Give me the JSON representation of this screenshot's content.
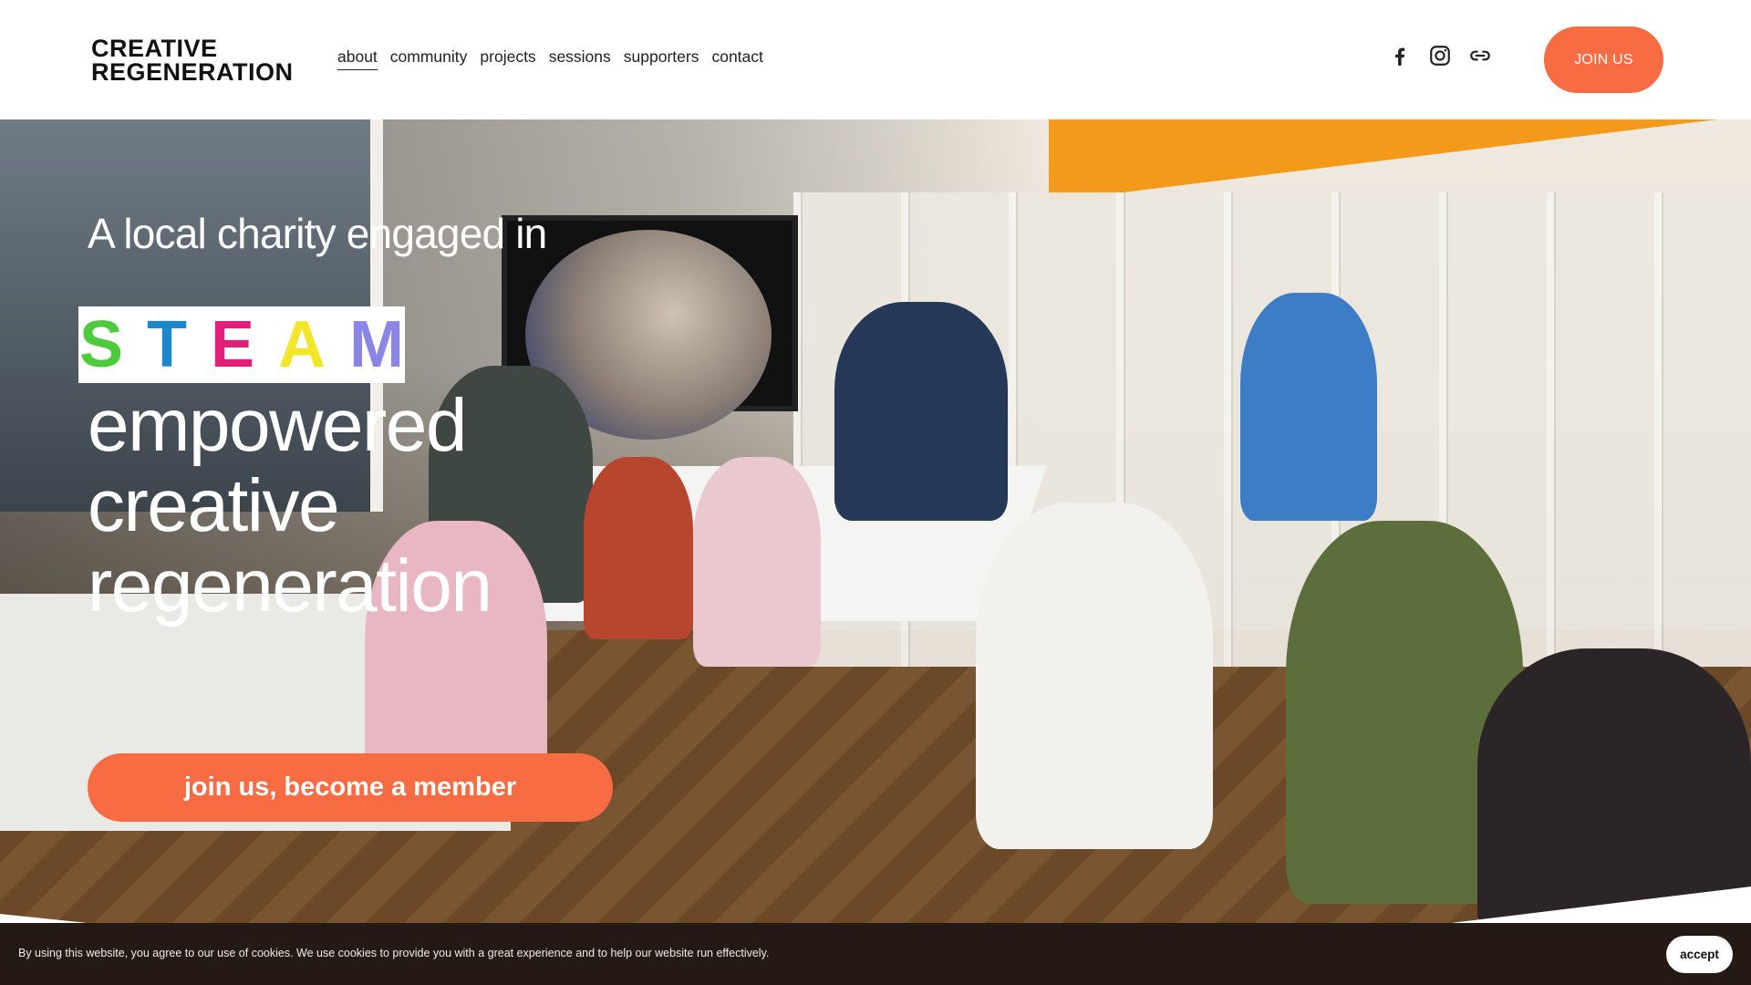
{
  "header": {
    "logo_line1": "CREATIVE",
    "logo_line2": "REGENERATION",
    "nav": [
      {
        "label": "about"
      },
      {
        "label": "community"
      },
      {
        "label": "projects"
      },
      {
        "label": "sessions"
      },
      {
        "label": "supporters"
      },
      {
        "label": "contact"
      }
    ],
    "social_icons": [
      "facebook-icon",
      "instagram-icon",
      "link-icon"
    ],
    "join_button": "JOIN US"
  },
  "hero": {
    "intro": "A local charity engaged in",
    "steam_letters": [
      {
        "char": "S",
        "color": "#4ecb3c"
      },
      {
        "char": "T",
        "color": "#1d88c9"
      },
      {
        "char": "E",
        "color": "#e0207a"
      },
      {
        "char": "A",
        "color": "#f1e62a"
      },
      {
        "char": "M",
        "color": "#8b86e6"
      }
    ],
    "line1": "empowered",
    "line2": "creative",
    "line3": "regeneration",
    "cta": "join us, become a member"
  },
  "cookie": {
    "text": "By using this website, you agree to our use of cookies. We use cookies to provide you with a great experience and to help our website run effectively.",
    "accept": "accept"
  },
  "colors": {
    "accent": "#f86c44",
    "cookie_bg": "#241914"
  }
}
